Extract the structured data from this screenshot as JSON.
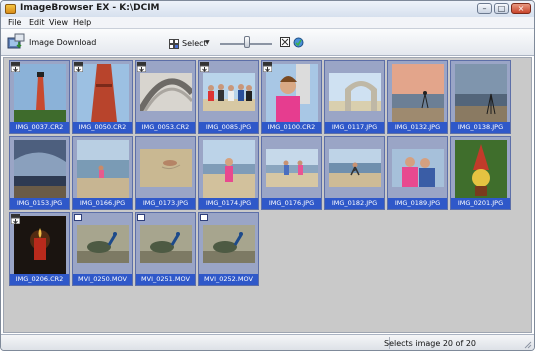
{
  "window": {
    "title": "ImageBrowser EX - K:\\DCIM",
    "buttons": [
      "–",
      "□",
      "×"
    ]
  },
  "menu": {
    "items": [
      "File",
      "Edit",
      "View",
      "Help"
    ]
  },
  "toolbar": {
    "download_label": "Image Download",
    "select_label": "Select",
    "icons": [
      "image-download-icon",
      "select-icon",
      "thumbnail-size-slider",
      "fit-view-icon",
      "effects-icon"
    ]
  },
  "thumbnails": [
    {
      "name": "IMG_0037.CR2",
      "kind": "raw"
    },
    {
      "name": "IMG_0050.CR2",
      "kind": "raw"
    },
    {
      "name": "IMG_0053.CR2",
      "kind": "raw"
    },
    {
      "name": "IMG_0085.JPG",
      "kind": "raw"
    },
    {
      "name": "IMG_0100.CR2",
      "kind": "raw"
    },
    {
      "name": "IMG_0117.JPG",
      "kind": "photo"
    },
    {
      "name": "IMG_0132.JPG",
      "kind": "photo"
    },
    {
      "name": "IMG_0138.JPG",
      "kind": "photo"
    },
    {
      "name": "IMG_0153.JPG",
      "kind": "photo"
    },
    {
      "name": "IMG_0166.JPG",
      "kind": "photo"
    },
    {
      "name": "IMG_0173.JPG",
      "kind": "photo"
    },
    {
      "name": "IMG_0174.JPG",
      "kind": "photo"
    },
    {
      "name": "IMG_0176.JPG",
      "kind": "photo"
    },
    {
      "name": "IMG_0182.JPG",
      "kind": "photo"
    },
    {
      "name": "IMG_0189.JPG",
      "kind": "photo"
    },
    {
      "name": "IMG_0201.JPG",
      "kind": "photo"
    },
    {
      "name": "IMG_0206.CR2",
      "kind": "raw"
    },
    {
      "name": "MVI_0250.MOV",
      "kind": "movie"
    },
    {
      "name": "MVI_0251.MOV",
      "kind": "movie"
    },
    {
      "name": "MVI_0252.MOV",
      "kind": "movie"
    }
  ],
  "status": {
    "text": "Selects image 20 of 20"
  },
  "colors": {
    "selection": "#2f58c9",
    "tile": "#9aa5c6",
    "background": "#c9c9c9"
  }
}
